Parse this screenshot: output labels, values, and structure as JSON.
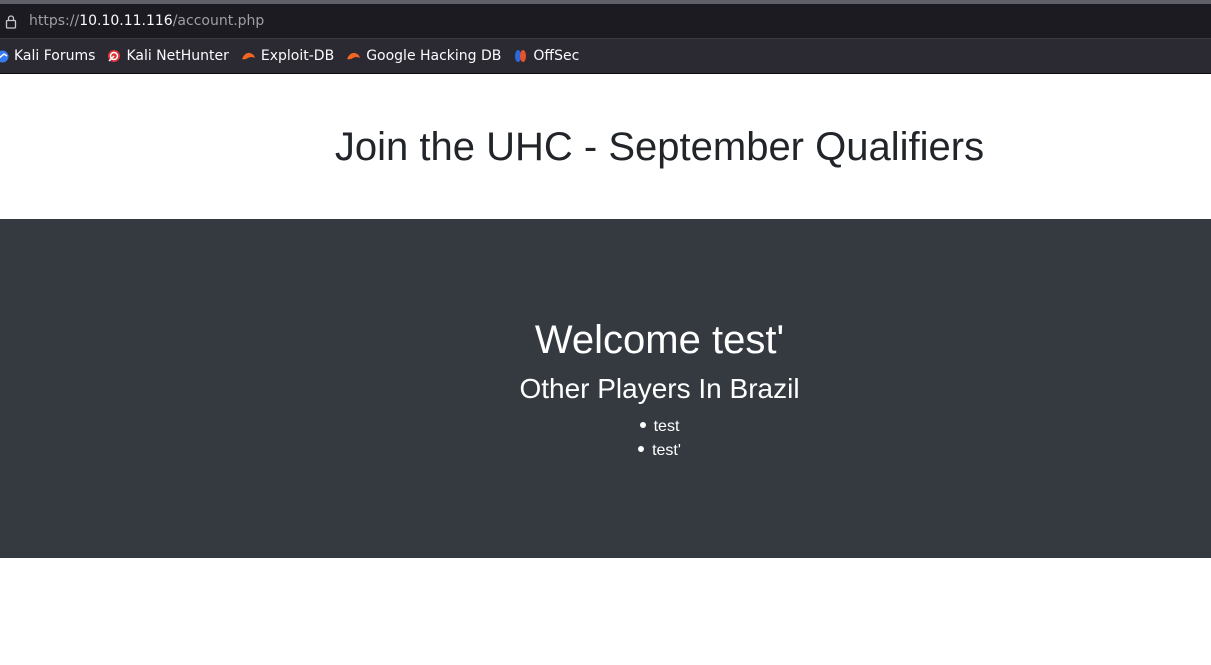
{
  "browser": {
    "url_prefix": "https://",
    "url_host": "10.10.11.116",
    "url_path": "/account.php"
  },
  "bookmarks": [
    {
      "label": "Kali Forums",
      "icon": "kali-forums-icon"
    },
    {
      "label": "Kali NetHunter",
      "icon": "kali-nethunter-icon"
    },
    {
      "label": "Exploit-DB",
      "icon": "exploit-db-icon"
    },
    {
      "label": "Google Hacking DB",
      "icon": "google-hacking-db-icon"
    },
    {
      "label": "OffSec",
      "icon": "offsec-icon"
    }
  ],
  "page": {
    "title": "Join the UHC - September Qualifiers",
    "welcome": "Welcome test'",
    "subtitle": "Other Players In Brazil",
    "players": [
      "test",
      "test'"
    ]
  },
  "colors": {
    "browser_bg": "#1c1b22",
    "toolbar_bg": "#2b2a33",
    "section_bg": "#343a40",
    "title_text": "#212529"
  }
}
